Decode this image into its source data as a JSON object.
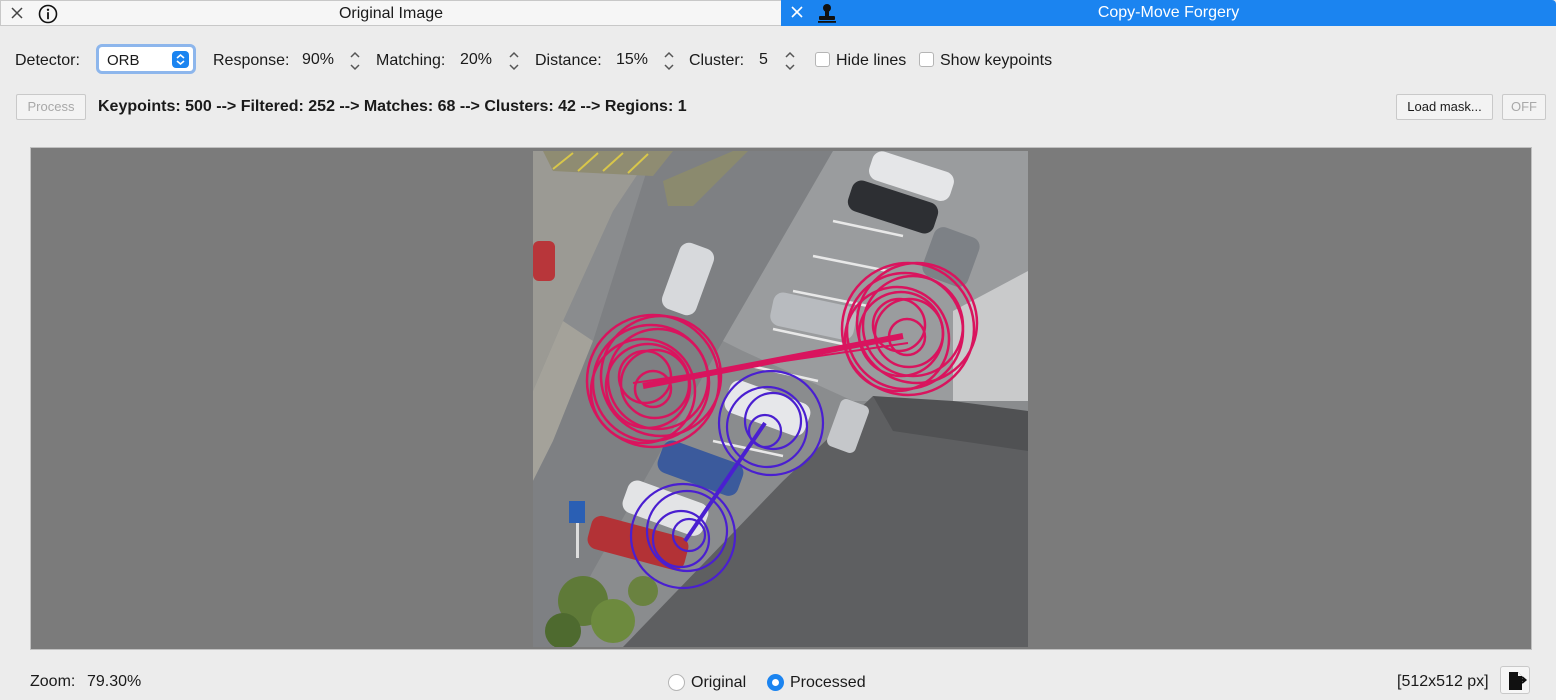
{
  "tabs": [
    {
      "title": "Original Image",
      "icon": "info-icon",
      "active": false
    },
    {
      "title": "Copy-Move Forgery",
      "icon": "stamp-icon",
      "active": true
    }
  ],
  "toolbar": {
    "detector_label": "Detector:",
    "detector_value": "ORB",
    "response_label": "Response:",
    "response_value": "90%",
    "matching_label": "Matching:",
    "matching_value": "20%",
    "distance_label": "Distance:",
    "distance_value": "15%",
    "cluster_label": "Cluster:",
    "cluster_value": "5",
    "hide_lines_label": "Hide lines",
    "hide_lines_checked": false,
    "show_keypoints_label": "Show keypoints",
    "show_keypoints_checked": false
  },
  "actions": {
    "process_label": "Process",
    "status": "Keypoints: 500 --> Filtered: 252 --> Matches: 68 --> Clusters: 42 --> Regions: 1",
    "load_mask_label": "Load mask...",
    "off_label": "OFF"
  },
  "viewer": {
    "accent_match_color": "#d9145e",
    "accent_region_color": "#4a1fd0"
  },
  "bottom": {
    "zoom_label": "Zoom:",
    "zoom_value": "79.30%",
    "view_original_label": "Original",
    "view_processed_label": "Processed",
    "selected_view": "Processed",
    "image_size": "[512x512 px]"
  },
  "colors": {
    "accent": "#1b84f0",
    "background": "#ececec",
    "viewer_background": "#7b7b7b"
  }
}
